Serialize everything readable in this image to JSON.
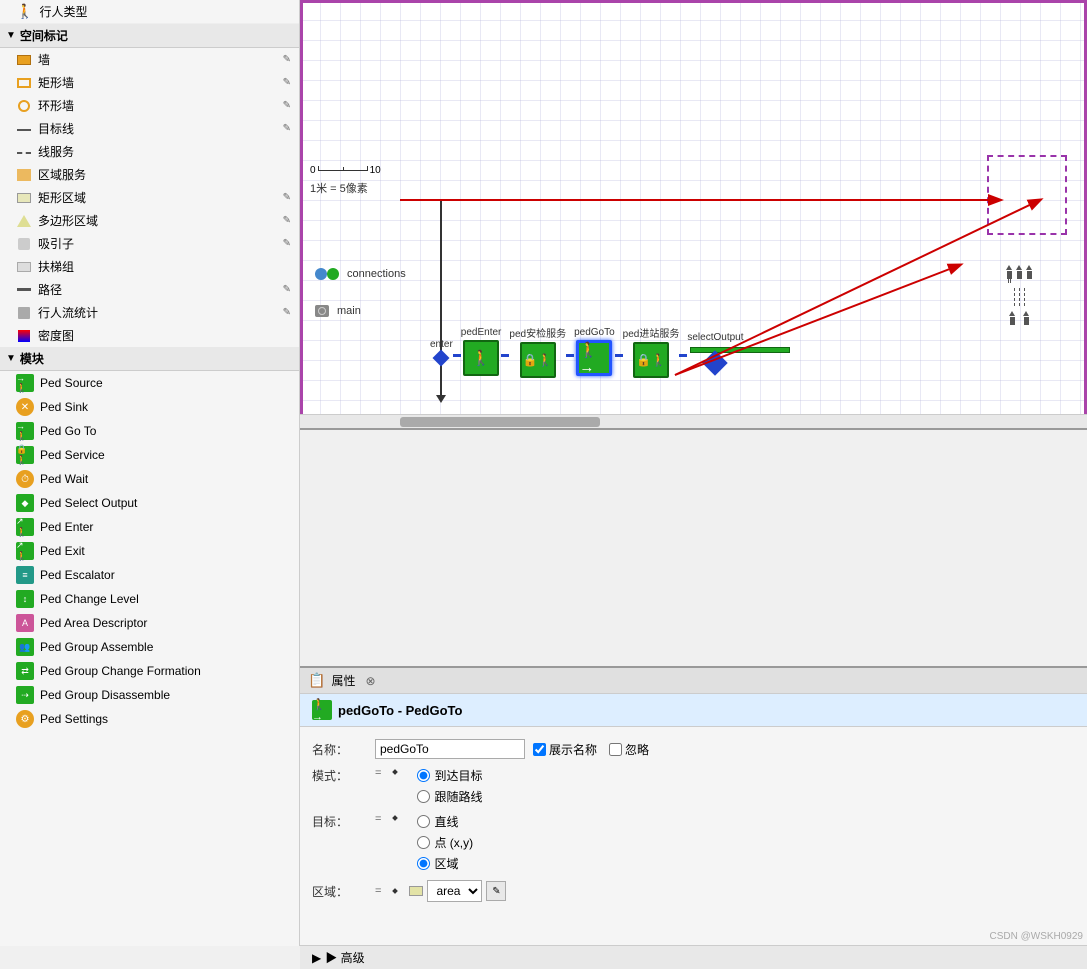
{
  "leftPanel": {
    "sections": [
      {
        "name": "空间标记",
        "items": [
          {
            "label": "墙",
            "iconType": "orange-rect",
            "hasEdit": true
          },
          {
            "label": "矩形墙",
            "iconType": "orange-rect",
            "hasEdit": true
          },
          {
            "label": "环形墙",
            "iconType": "circle-outline",
            "hasEdit": true
          },
          {
            "label": "目标线",
            "iconType": "line",
            "hasEdit": true
          },
          {
            "label": "线服务",
            "iconType": "dashed",
            "hasEdit": false
          },
          {
            "label": "区域服务",
            "iconType": "service",
            "hasEdit": false
          },
          {
            "label": "矩形区域",
            "iconType": "area-rect",
            "hasEdit": true
          },
          {
            "label": "多边形区域",
            "iconType": "polygon",
            "hasEdit": true
          },
          {
            "label": "吸引子",
            "iconType": "attractor",
            "hasEdit": true
          },
          {
            "label": "扶梯组",
            "iconType": "escalator",
            "hasEdit": false
          },
          {
            "label": "路径",
            "iconType": "path",
            "hasEdit": true
          },
          {
            "label": "行人流统计",
            "iconType": "stat",
            "hasEdit": true
          },
          {
            "label": "密度图",
            "iconType": "density",
            "hasEdit": false
          }
        ]
      },
      {
        "name": "模块",
        "items": [
          {
            "label": "Ped Source",
            "iconType": "mod-green",
            "iconChar": "→🚶"
          },
          {
            "label": "Ped Sink",
            "iconType": "mod-orange",
            "iconChar": "✕"
          },
          {
            "label": "Ped Go To",
            "iconType": "mod-green",
            "iconChar": "→🚶"
          },
          {
            "label": "Ped Service",
            "iconType": "mod-green",
            "iconChar": "🔒🚶"
          },
          {
            "label": "Ped Wait",
            "iconType": "mod-orange-circle",
            "iconChar": "⏱"
          },
          {
            "label": "Ped Select Output",
            "iconType": "mod-green",
            "iconChar": "◆"
          },
          {
            "label": "Ped Enter",
            "iconType": "mod-green",
            "iconChar": "↗"
          },
          {
            "label": "Ped Exit",
            "iconType": "mod-green",
            "iconChar": "↗"
          },
          {
            "label": "Ped Escalator",
            "iconType": "mod-teal",
            "iconChar": "≡"
          },
          {
            "label": "Ped Change Level",
            "iconType": "mod-green",
            "iconChar": "↕"
          },
          {
            "label": "Ped Area Descriptor",
            "iconType": "mod-pink",
            "iconChar": "A"
          },
          {
            "label": "Ped Group Assemble",
            "iconType": "mod-green",
            "iconChar": "👥"
          },
          {
            "label": "Ped Group Change Formation",
            "iconType": "mod-green",
            "iconChar": "⇄"
          },
          {
            "label": "Ped Group Disassemble",
            "iconType": "mod-green",
            "iconChar": "⇢"
          },
          {
            "label": "Ped Settings",
            "iconType": "mod-orange",
            "iconChar": "⚙"
          }
        ]
      }
    ]
  },
  "canvas": {
    "connections_label": "connections",
    "main_label": "main",
    "ruler_zero": "0",
    "ruler_ten": "10",
    "scale_text": "1米 = 5像素",
    "flowNodes": [
      {
        "label": "enter",
        "type": "source"
      },
      {
        "label": "pedEnter",
        "type": "green-goto"
      },
      {
        "label": "ped安检服务",
        "type": "green-service"
      },
      {
        "label": "pedGoTo",
        "type": "green-goto",
        "selected": true
      },
      {
        "label": "ped进站服务",
        "type": "green-service"
      },
      {
        "label": "selectOutput",
        "type": "diamond"
      }
    ]
  },
  "properties": {
    "header_label": "属性",
    "title_icon": "→🚶",
    "title_text": "pedGoTo - PedGoTo",
    "fields": {
      "name_label": "名称：",
      "name_value": "pedGoTo",
      "show_name_label": "展示名称",
      "ignore_label": "忽略",
      "mode_label": "模式：",
      "mode_options": [
        "到达目标",
        "跟随路线"
      ],
      "mode_selected": "到达目标",
      "target_label": "目标：",
      "target_options": [
        "直线",
        "点 (x,y)",
        "区域"
      ],
      "target_selected": "区域",
      "zone_label": "区域：",
      "zone_value": "area",
      "advanced_label": "▶ 高级"
    }
  },
  "watermark": "CSDN @WSKH0929"
}
